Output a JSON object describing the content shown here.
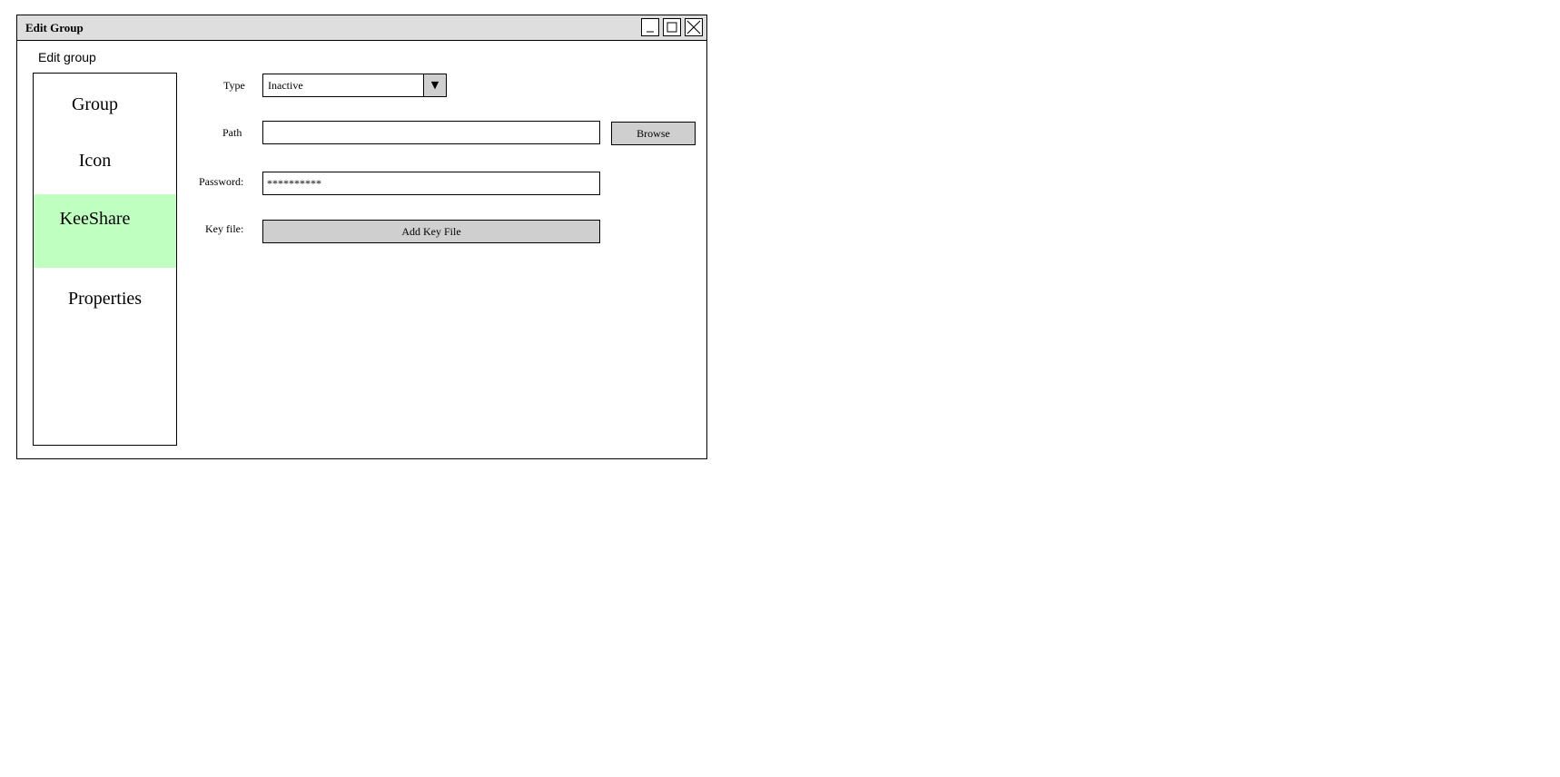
{
  "window": {
    "title": "Edit Group",
    "controls": {
      "minimize": "minimize-icon",
      "maximize": "maximize-icon",
      "close": "close-icon"
    }
  },
  "heading": "Edit group",
  "sidebar": {
    "items": [
      {
        "label": "Group",
        "selected": false
      },
      {
        "label": "Icon",
        "selected": false
      },
      {
        "label": "KeeShare",
        "selected": true
      },
      {
        "label": "Properties",
        "selected": false
      }
    ],
    "selected_color": "#bfffbf"
  },
  "form": {
    "type_label": "Type",
    "type_value": "Inactive",
    "path_label": "Path",
    "path_value": "",
    "browse_label": "Browse",
    "password_label": "Password:",
    "password_value": "**********",
    "keyfile_label": "Key file:",
    "add_key_label": "Add Key File"
  }
}
